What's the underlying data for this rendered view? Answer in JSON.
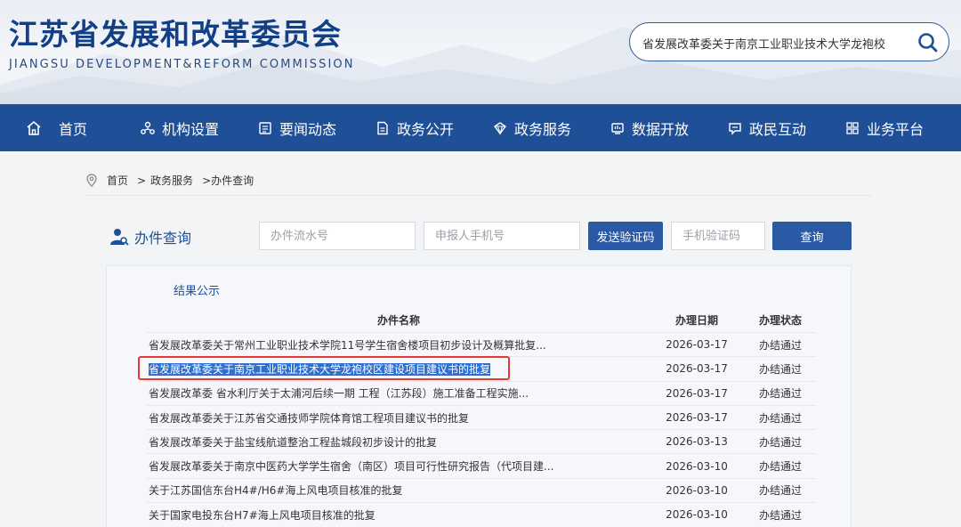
{
  "header": {
    "title": "江苏省发展和改革委员会",
    "subtitle": "JIANGSU DEVELOPMENT&REFORM COMMISSION",
    "search_value": "省发展改革委关于南京工业职业技术大学龙袍校",
    "search_icon": "search-icon"
  },
  "nav": {
    "items": [
      {
        "label": "首页",
        "icon": "home-icon"
      },
      {
        "label": "机构设置",
        "icon": "org-icon"
      },
      {
        "label": "要闻动态",
        "icon": "news-icon"
      },
      {
        "label": "政务公开",
        "icon": "doc-icon"
      },
      {
        "label": "政务服务",
        "icon": "service-icon"
      },
      {
        "label": "数据开放",
        "icon": "data-icon"
      },
      {
        "label": "政民互动",
        "icon": "chat-icon"
      },
      {
        "label": "业务平台",
        "icon": "grid-icon"
      }
    ]
  },
  "breadcrumb": {
    "home": "首页",
    "sep1": ">",
    "level1": "政务服务",
    "sep2": ">",
    "level2": "办件查询"
  },
  "query": {
    "label": "办件查询",
    "serial_placeholder": "办件流水号",
    "phone_placeholder": "申报人手机号",
    "send_code_label": "发送验证码",
    "code_placeholder": "手机验证码",
    "search_label": "查询"
  },
  "results": {
    "title": "结果公示",
    "columns": {
      "name": "办件名称",
      "date": "办理日期",
      "status": "办理状态"
    },
    "rows": [
      {
        "name": "省发展改革委关于常州工业职业技术学院11号学生宿舍楼项目初步设计及概算批复...",
        "date": "2026-03-17",
        "status": "办结通过"
      },
      {
        "name": "省发展改革委关于南京工业职业技术大学龙袍校区建设项目建议书的批复",
        "date": "2026-03-17",
        "status": "办结通过"
      },
      {
        "name": "省发展改革委 省水利厅关于太浦河后续一期 工程（江苏段）施工准备工程实施...",
        "date": "2026-03-17",
        "status": "办结通过"
      },
      {
        "name": "省发展改革委关于江苏省交通技师学院体育馆工程项目建议书的批复",
        "date": "2026-03-17",
        "status": "办结通过"
      },
      {
        "name": "省发展改革委关于盐宝线航道整治工程盐城段初步设计的批复",
        "date": "2026-03-13",
        "status": "办结通过"
      },
      {
        "name": "省发展改革委关于南京中医药大学学生宿舍（南区）项目可行性研究报告（代项目建...",
        "date": "2026-03-10",
        "status": "办结通过"
      },
      {
        "name": "关于江苏国信东台H4#/H6#海上风电项目核准的批复",
        "date": "2026-03-10",
        "status": "办结通过"
      },
      {
        "name": "关于国家电投东台H7#海上风电项目核准的批复",
        "date": "2026-03-10",
        "status": "办结通过"
      }
    ]
  },
  "colors": {
    "brand": "#1f4f97",
    "highlight": "#2f6fd0",
    "annotation": "#e53935"
  }
}
